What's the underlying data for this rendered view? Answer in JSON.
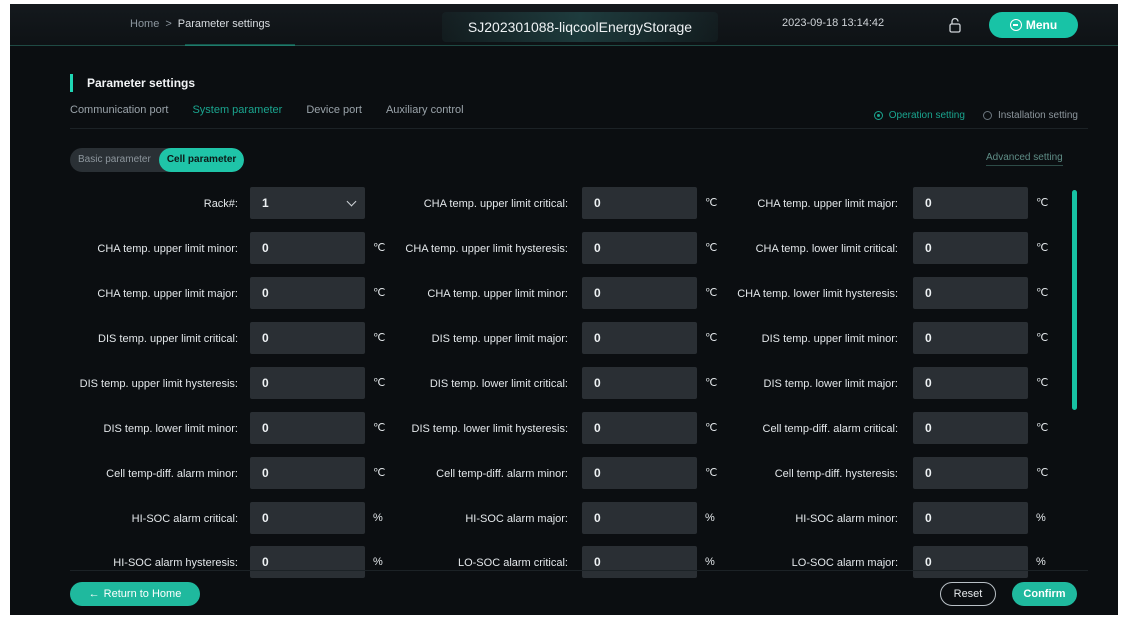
{
  "header": {
    "breadcrumb_home": "Home",
    "breadcrumb_sep": ">",
    "breadcrumb_current": "Parameter settings",
    "device_name": "SJ202301088-liqcoolEnergyStorage",
    "datetime": "2023-09-18 13:14:42",
    "menu_label": "Menu"
  },
  "panel": {
    "title": "Parameter settings",
    "tabs": [
      "Communication port",
      "System parameter",
      "Device port",
      "Auxiliary control"
    ],
    "active_tab": 1,
    "radios": [
      {
        "label": "Operation setting",
        "selected": true
      },
      {
        "label": "Installation setting",
        "selected": false
      }
    ],
    "subtabs": [
      "Basic parameter",
      "Cell parameter"
    ],
    "active_subtab": 1,
    "advanced_link": "Advanced setting"
  },
  "rows": [
    [
      {
        "label": "Rack#:",
        "value": "1",
        "unit": "",
        "dropdown": true
      },
      {
        "label": "CHA temp. upper limit critical:",
        "value": "0",
        "unit": "℃"
      },
      {
        "label": "CHA temp. upper limit major:",
        "value": "0",
        "unit": "℃"
      }
    ],
    [
      {
        "label": "CHA temp. upper limit minor:",
        "value": "0",
        "unit": "℃"
      },
      {
        "label": "CHA temp. upper limit hysteresis:",
        "value": "0",
        "unit": "℃"
      },
      {
        "label": "CHA temp. lower limit critical:",
        "value": "0",
        "unit": "℃"
      }
    ],
    [
      {
        "label": "CHA temp. upper limit major:",
        "value": "0",
        "unit": "℃"
      },
      {
        "label": "CHA temp. upper limit minor:",
        "value": "0",
        "unit": "℃"
      },
      {
        "label": "CHA temp. lower limit hysteresis:",
        "value": "0",
        "unit": "℃"
      }
    ],
    [
      {
        "label": "DIS temp. upper limit critical:",
        "value": "0",
        "unit": "℃"
      },
      {
        "label": "DIS temp. upper limit major:",
        "value": "0",
        "unit": "℃"
      },
      {
        "label": "DIS temp. upper limit minor:",
        "value": "0",
        "unit": "℃"
      }
    ],
    [
      {
        "label": "DIS temp. upper limit hysteresis:",
        "value": "0",
        "unit": "℃"
      },
      {
        "label": "DIS temp. lower limit critical:",
        "value": "0",
        "unit": "℃"
      },
      {
        "label": "DIS temp. lower limit major:",
        "value": "0",
        "unit": "℃"
      }
    ],
    [
      {
        "label": "DIS temp. lower limit minor:",
        "value": "0",
        "unit": "℃"
      },
      {
        "label": "DIS temp. lower limit hysteresis:",
        "value": "0",
        "unit": "℃"
      },
      {
        "label": "Cell temp-diff. alarm critical:",
        "value": "0",
        "unit": "℃"
      }
    ],
    [
      {
        "label": "Cell temp-diff. alarm minor:",
        "value": "0",
        "unit": "℃"
      },
      {
        "label": "Cell temp-diff. alarm minor:",
        "value": "0",
        "unit": "℃"
      },
      {
        "label": "Cell temp-diff. hysteresis:",
        "value": "0",
        "unit": "℃"
      }
    ],
    [
      {
        "label": "HI-SOC alarm critical:",
        "value": "0",
        "unit": "%"
      },
      {
        "label": "HI-SOC alarm major:",
        "value": "0",
        "unit": "%"
      },
      {
        "label": "HI-SOC alarm minor:",
        "value": "0",
        "unit": "%"
      }
    ],
    [
      {
        "label": "HI-SOC alarm hysteresis:",
        "value": "0",
        "unit": "%"
      },
      {
        "label": "LO-SOC alarm critical:",
        "value": "0",
        "unit": "%"
      },
      {
        "label": "LO-SOC alarm major:",
        "value": "0",
        "unit": "%"
      }
    ]
  ],
  "footer": {
    "home_label": "Return to Home",
    "reset_label": "Reset",
    "confirm_label": "Confirm"
  },
  "colors": {
    "accent": "#1fc4a8",
    "background": "#0b0e11",
    "input": "#2a2f34"
  }
}
